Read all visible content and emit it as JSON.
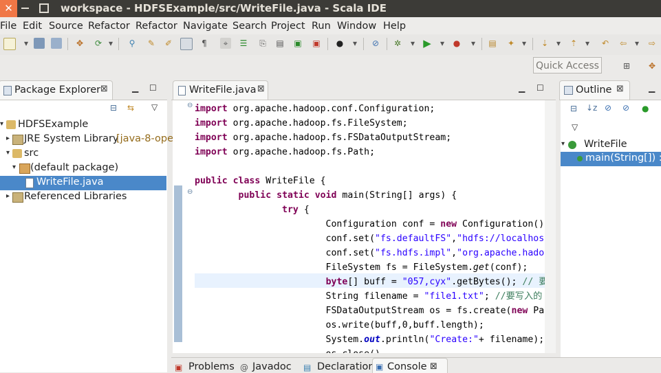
{
  "window": {
    "title": "workspace - HDFSExample/src/WriteFile.java - Scala IDE",
    "close_glyph": "✕"
  },
  "menu": [
    "File",
    "Edit",
    "Source",
    "Refactor",
    "Refactor",
    "Navigate",
    "Search",
    "Project",
    "Run",
    "Window",
    "Help"
  ],
  "toolbar": {
    "quick_access_label": "Quick Access"
  },
  "package_explorer": {
    "tab_label": "Package Explorer",
    "tree": [
      {
        "label": "HDFSExample",
        "icon": "project-folder-icon",
        "expanded": true
      },
      {
        "label": "JRE System Library",
        "suffix": "[java-8-ope",
        "icon": "library-icon",
        "expanded": false
      },
      {
        "label": "src",
        "icon": "source-folder-icon",
        "expanded": true
      },
      {
        "label": "(default package)",
        "icon": "package-icon",
        "expanded": true
      },
      {
        "label": "WriteFile.java",
        "icon": "java-file-icon",
        "selected": true
      },
      {
        "label": "Referenced Libraries",
        "icon": "library-icon",
        "expanded": false
      }
    ]
  },
  "editor": {
    "tab_label": "WriteFile.java",
    "code": [
      "import org.apache.hadoop.conf.Configuration;",
      "import org.apache.hadoop.fs.FileSystem;",
      "import org.apache.hadoop.fs.FSDataOutputStream;",
      "import org.apache.hadoop.fs.Path;",
      "",
      "public class WriteFile {",
      "        public static void main(String[] args) {",
      "                try {",
      "                        Configuration conf = new Configuration()",
      "                        conf.set(\"fs.defaultFS\",\"hdfs://localhos",
      "                        conf.set(\"fs.hdfs.impl\",\"org.apache.hado",
      "                        FileSystem fs = FileSystem.get(conf);",
      "                        byte[] buff = \"057,cyx\".getBytes(); // 要",
      "                        String filename = \"file1.txt\"; //要写入的",
      "                        FSDataOutputStream os = fs.create(new Pa",
      "                        os.write(buff,0,buff.length);",
      "                        System.out.println(\"Create:\"+ filename);",
      "                        os.close()"
    ]
  },
  "outline": {
    "tab_label": "Outline",
    "class_name": "WriteFile",
    "method_name": "main(String[]) :"
  },
  "bottom_tabs": [
    "Problems",
    "Javadoc",
    "Declaration",
    "Console"
  ],
  "colors": {
    "titlebar": "#3c3b37",
    "close_button": "#f07746",
    "selection": "#4a88c9",
    "keyword": "#7f0055",
    "string": "#2a00ff",
    "comment": "#3f7f5f"
  }
}
